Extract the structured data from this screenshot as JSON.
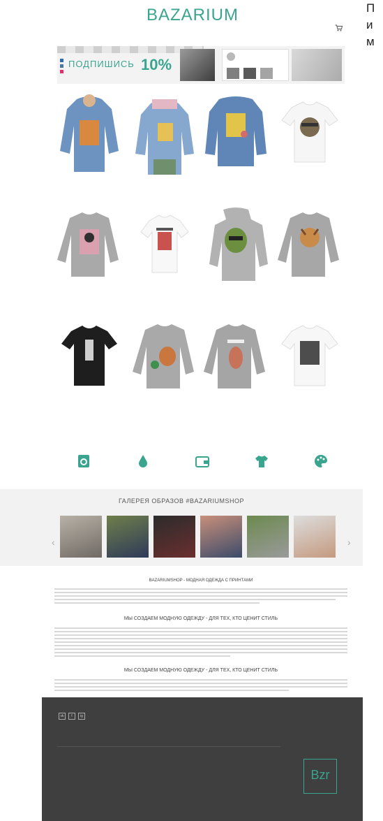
{
  "side_caption": [
    "П",
    "и",
    "м"
  ],
  "header": {
    "top_links": [
      "",
      ""
    ],
    "logo_sup": "",
    "logo": "BAZARIUM",
    "phone": "",
    "cart_lines": [
      "",
      ""
    ],
    "nav": [
      "",
      "",
      "",
      ""
    ]
  },
  "banner": {
    "subscribe_text": "ПОДПИШИСЬ",
    "discount": "10%",
    "note": ""
  },
  "products": [
    {
      "name": "",
      "price": ""
    },
    {
      "name": "",
      "price": ""
    },
    {
      "name": "",
      "price": ""
    },
    {
      "name": "",
      "price": ""
    },
    {
      "name": "",
      "price": ""
    },
    {
      "name": "",
      "price": ""
    },
    {
      "name": "",
      "price": ""
    },
    {
      "name": "",
      "price": ""
    },
    {
      "name": "",
      "price": ""
    },
    {
      "name": "",
      "price": ""
    },
    {
      "name": "",
      "price": ""
    },
    {
      "name": "",
      "price": ""
    }
  ],
  "features": [
    {
      "icon": "washing-machine-icon",
      "label": ""
    },
    {
      "icon": "drop-icon",
      "label": ""
    },
    {
      "icon": "wallet-icon",
      "label": ""
    },
    {
      "icon": "tshirt-icon",
      "label": ""
    },
    {
      "icon": "palette-icon",
      "label": ""
    }
  ],
  "gallery": {
    "title": "ГАЛЕРЕЯ ОБРАЗОВ #BAZARIUMSHOP",
    "subtitle": "",
    "prev": "‹",
    "next": "›"
  },
  "seo": {
    "heading1": "BAZARIUMSHOP - МОДНАЯ ОДЕЖДА С ПРИНТАМИ",
    "heading2": "МЫ СОЗДАЕМ МОДНУЮ ОДЕЖДУ - ДЛЯ ТЕХ, КТО ЦЕНИТ СТИЛЬ",
    "heading3": "МЫ СОЗДАЕМ МОДНУЮ ОДЕЖДУ - ДЛЯ ТЕХ, КТО ЦЕНИТ СТИЛЬ",
    "more": ""
  },
  "footer": {
    "social": [
      "vk",
      "f",
      "ig"
    ],
    "col1_title": "",
    "col2_title": "",
    "col1_items": [
      "",
      "",
      "",
      ""
    ],
    "col2_items": [
      "",
      ""
    ],
    "brand": "Bzr",
    "brand_sub": ""
  },
  "colors": {
    "brand": "#3aa58f",
    "sale": "#e26060",
    "footer_bg": "#3f3f3f"
  }
}
